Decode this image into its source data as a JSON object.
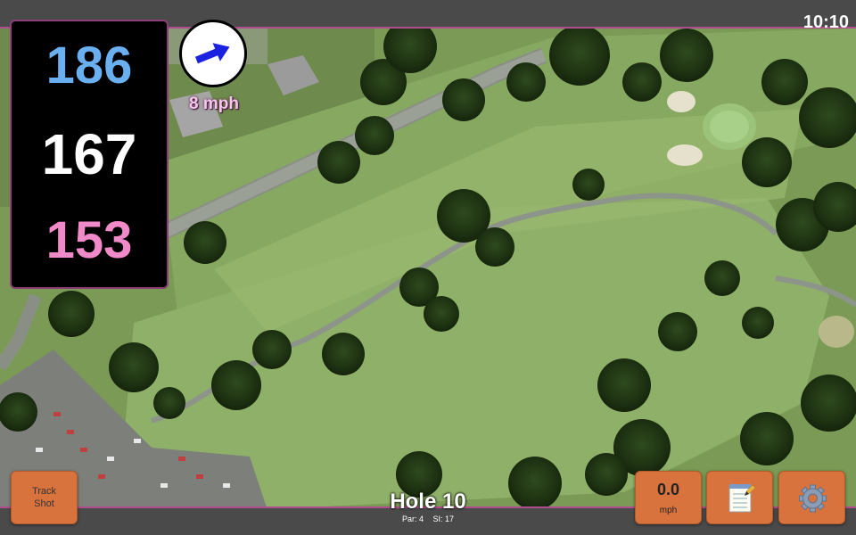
{
  "status_bar": {
    "time": "10:10"
  },
  "distances": {
    "back": "186",
    "center": "167",
    "front": "153"
  },
  "wind": {
    "speed_label": "8 mph",
    "arrow_icon": "wind-direction-arrow-icon"
  },
  "hole": {
    "title": "Hole 10",
    "par": "Par: 4",
    "stroke_index": "SI: 17"
  },
  "buttons": {
    "track_shot_line1": "Track",
    "track_shot_line2": "Shot",
    "speed_value": "0.0",
    "speed_unit": "mph",
    "notes_icon": "notepad-icon",
    "settings_icon": "gear-icon"
  },
  "colors": {
    "back_distance": "#6ab0f0",
    "center_distance": "#ffffff",
    "front_distance": "#f08ac8",
    "button_orange": "#d9733e",
    "border_magenta": "#b04d8d"
  }
}
